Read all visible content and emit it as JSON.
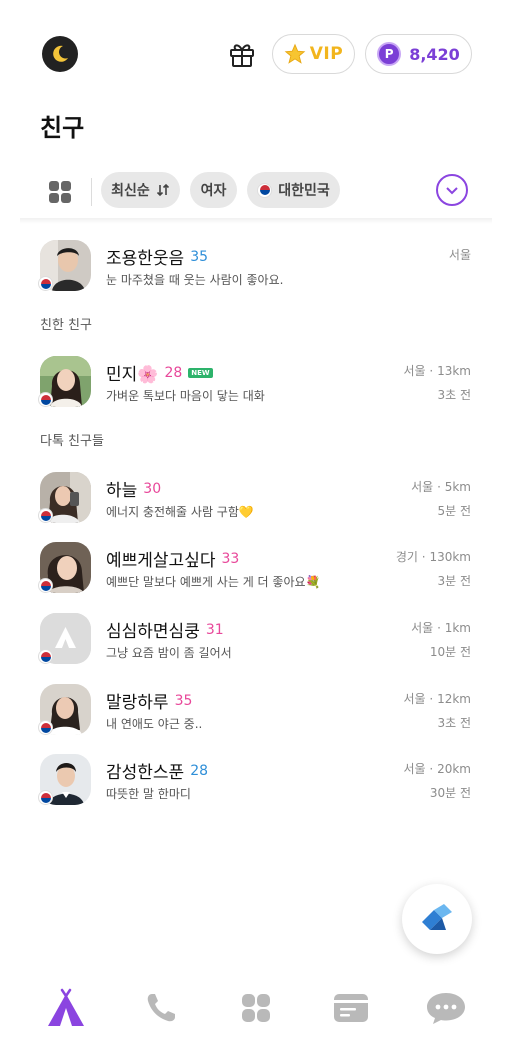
{
  "header": {
    "vip_label": "VIP",
    "points": "8,420",
    "point_badge": "P"
  },
  "page_title": "친구",
  "filters": {
    "sort": "최신순",
    "gender": "여자",
    "country": "대한민국"
  },
  "my_profile": {
    "name": "조용한웃음",
    "age": "35",
    "status": "눈 마주쳤을 때 웃는 사람이 좋아요.",
    "location": "서울"
  },
  "sections": {
    "close_friends": "친한 친구",
    "chat_friends": "다톡 친구들"
  },
  "close_friends": [
    {
      "name": "민지🌸",
      "age": "28",
      "badge": "NEW",
      "status": "가벼운 톡보다 마음이 닿는 대화",
      "location": "서울",
      "distance": "13km",
      "time": "3초 전"
    }
  ],
  "friends": [
    {
      "name": "하늘",
      "age": "30",
      "status": "에너지 충전해줄 사람 구함💛",
      "location": "서울",
      "distance": "5km",
      "time": "5분 전"
    },
    {
      "name": "예쁘게살고싶다",
      "age": "33",
      "status": "예쁘단 말보다 예쁘게 사는 게 더 좋아요💐",
      "location": "경기",
      "distance": "130km",
      "time": "3분 전"
    },
    {
      "name": "심심하면심쿵",
      "age": "31",
      "status": "그냥 요즘 밤이 좀 길어서",
      "location": "서울",
      "distance": "1km",
      "time": "10분 전"
    },
    {
      "name": "말랑하루",
      "age": "35",
      "status": "내 연애도 야근 중..",
      "location": "서울",
      "distance": "12km",
      "time": "3초 전"
    },
    {
      "name": "감성한스푼",
      "age": "28",
      "status": "따뜻한 말 한마디",
      "location": "서울",
      "distance": "20km",
      "time": "30분 전"
    }
  ],
  "meta_separator": "·",
  "colors": {
    "accent": "#8b45e0",
    "vip": "#f2b51d",
    "male_age": "#2f8fd8",
    "female_age": "#e8489a"
  }
}
